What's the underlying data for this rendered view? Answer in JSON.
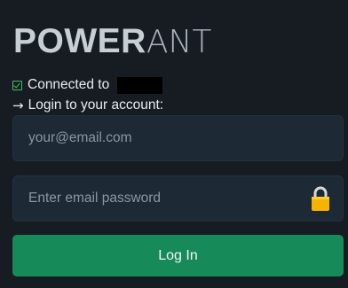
{
  "brand": {
    "bold_part": "POWER",
    "light_part": "ANT"
  },
  "status": {
    "text": "Connected to",
    "check_color": "#3fbf5f"
  },
  "prompt": {
    "text": "Login to your account:"
  },
  "email": {
    "placeholder": "your@email.com",
    "value": ""
  },
  "password": {
    "placeholder": "Enter email password",
    "value": "",
    "lock_icon": "lock-icon",
    "lock_color": "#f5b400"
  },
  "login_button": {
    "label": "Log In",
    "color": "#178a59"
  },
  "colors": {
    "background": "#161c22",
    "field_background": "#1d2a35"
  }
}
